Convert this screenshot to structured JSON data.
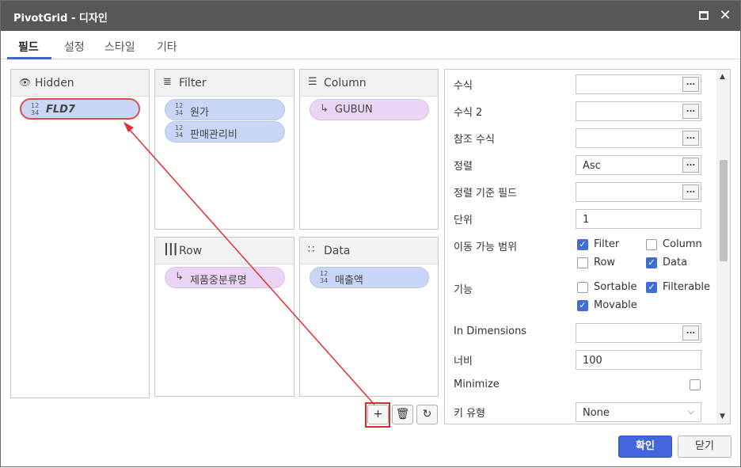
{
  "window": {
    "title": "PivotGrid - 디자인"
  },
  "tabs": [
    {
      "label": "필드"
    },
    {
      "label": "설정"
    },
    {
      "label": "스타일"
    },
    {
      "label": "기타"
    }
  ],
  "panels": {
    "hidden": {
      "title": "Hidden",
      "icon": "eye-slash-icon",
      "items": [
        {
          "label": "FLD7",
          "icon": "numeric-field-icon",
          "icon_text": "12 34"
        }
      ]
    },
    "filter": {
      "title": "Filter",
      "icon": "filter-icon",
      "items": [
        {
          "label": "원가",
          "icon": "numeric-field-icon",
          "icon_text": "12 34"
        },
        {
          "label": "판매관리비",
          "icon": "numeric-field-icon",
          "icon_text": "12 34"
        }
      ]
    },
    "column": {
      "title": "Column",
      "icon": "column-list-icon",
      "items": [
        {
          "label": "GUBUN",
          "icon": "dimension-field-icon"
        }
      ]
    },
    "row": {
      "title": "Row",
      "icon": "row-bars-icon",
      "items": [
        {
          "label": "제품중분류명",
          "icon": "dimension-field-icon"
        }
      ]
    },
    "data": {
      "title": "Data",
      "icon": "data-grid-icon",
      "items": [
        {
          "label": "매출액",
          "icon": "numeric-field-icon",
          "icon_text": "12 34"
        }
      ]
    }
  },
  "actions": {
    "add": "+",
    "delete_icon": "trash-icon",
    "refresh_icon": "refresh-icon"
  },
  "properties": {
    "formula": {
      "label": "수식",
      "value": ""
    },
    "formula2": {
      "label": "수식 2",
      "value": ""
    },
    "ref_formula": {
      "label": "참조 수식",
      "value": ""
    },
    "sort": {
      "label": "정렬",
      "value": "Asc"
    },
    "sort_field": {
      "label": "정렬 기준 필드",
      "value": ""
    },
    "unit": {
      "label": "단위",
      "value": "1"
    },
    "move_range": {
      "label": "이동 가능 범위",
      "options": [
        {
          "label": "Filter",
          "checked": true
        },
        {
          "label": "Column",
          "checked": false
        },
        {
          "label": "Row",
          "checked": false
        },
        {
          "label": "Data",
          "checked": true
        }
      ]
    },
    "features": {
      "label": "기능",
      "options": [
        {
          "label": "Sortable",
          "checked": false
        },
        {
          "label": "Filterable",
          "checked": true
        },
        {
          "label": "Movable",
          "checked": true
        }
      ]
    },
    "in_dimensions": {
      "label": "In Dimensions",
      "value": ""
    },
    "width": {
      "label": "너비",
      "value": "100"
    },
    "minimize": {
      "label": "Minimize",
      "checked": false
    },
    "key_type": {
      "label": "키 유형",
      "value": "None"
    },
    "ellipsis": "..."
  },
  "footer": {
    "ok": "확인",
    "close": "닫기"
  },
  "colors": {
    "accent": "#4466dd",
    "highlight": "#d32f2f",
    "pill_blue": "#c9d6f7",
    "pill_purple": "#ebd5f5"
  }
}
